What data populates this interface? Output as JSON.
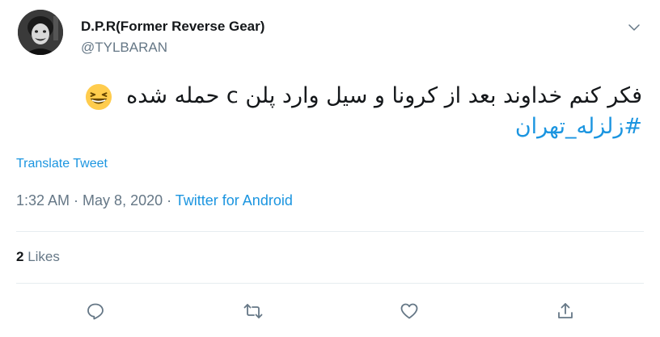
{
  "author": {
    "display_name": "D.P.R(Former Reverse Gear)",
    "handle": "@TYLBARAN",
    "avatar_icon": "avatar-photo"
  },
  "tweet": {
    "text_line1": "فکر کنم خداوند بعد از کرونا و سیل وارد پلن c حمله شده",
    "emoji_icon": "grinning-squinting-face-emoji",
    "hashtag": "#زلزله_تهران",
    "translate_label": "Translate Tweet"
  },
  "meta": {
    "time": "1:32 AM",
    "separator": " · ",
    "date": "May 8, 2020",
    "source": "Twitter for Android"
  },
  "stats": {
    "likes_count": "2",
    "likes_label": "Likes"
  },
  "actions": [
    "reply-icon",
    "retweet-icon",
    "like-icon",
    "share-icon"
  ],
  "colors": {
    "link": "#1b95e0",
    "muted": "#657786",
    "text": "#14171a",
    "divider": "#e6ecf0"
  }
}
